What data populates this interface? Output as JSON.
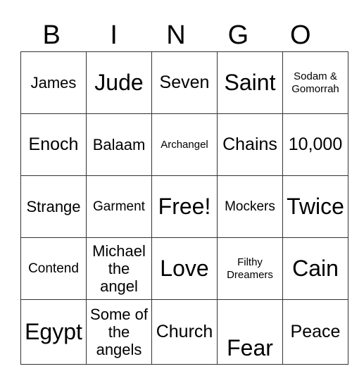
{
  "header": [
    "B",
    "I",
    "N",
    "G",
    "O"
  ],
  "rows": [
    [
      "James",
      "Jude",
      "Seven",
      "Saint",
      "Sodam & Gomorrah"
    ],
    [
      "Enoch",
      "Balaam",
      "Archangel",
      "Chains",
      "10,000"
    ],
    [
      "Strange",
      "Garment",
      "Free!",
      "Mockers",
      "Twice"
    ],
    [
      "Contend",
      "Michael the angel",
      "Love",
      "Filthy Dreamers",
      "Cain"
    ],
    [
      "Egypt",
      "Some of the angels",
      "Church",
      "Fear",
      "Peace"
    ]
  ]
}
